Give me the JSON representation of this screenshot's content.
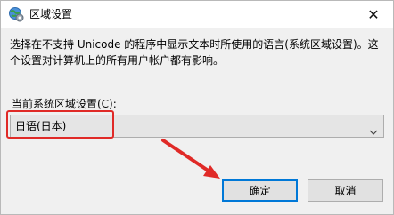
{
  "window": {
    "title": "区域设置",
    "icon": "globe-settings-icon",
    "close_glyph": "✕"
  },
  "content": {
    "description": "选择在不支持 Unicode 的程序中显示文本时所使用的语言(系统区域设置)。这个设置对计算机上的所有用户帐户都有影响。",
    "locale_label": "当前系统区域设置(C):",
    "locale_value": "日语(日本)"
  },
  "buttons": {
    "ok_label": "确定",
    "cancel_label": "取消"
  },
  "annotations": {
    "highlight_color": "#e02a27",
    "arrow_color": "#e02a27"
  }
}
